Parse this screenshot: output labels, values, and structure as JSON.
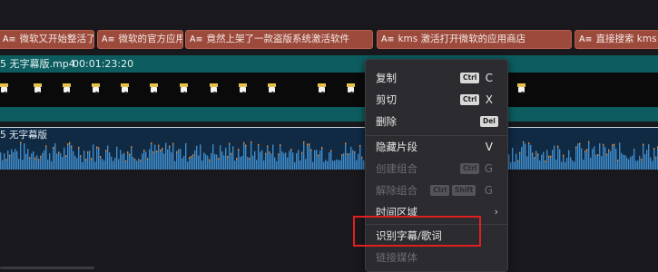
{
  "subtitle_track": {
    "tag": "A≡",
    "clips": [
      {
        "text": "微软又开始整活了"
      },
      {
        "text": "微软的官方应用"
      },
      {
        "text": "竟然上架了一款盗版系统激活软件"
      },
      {
        "text": "kms 激活打开微软的应用商店"
      },
      {
        "text": "直接搜索 kms"
      }
    ]
  },
  "video_track": {
    "name": "5 无字幕版.mp4",
    "duration": "00:01:23:20",
    "thumbnail_icon": "clip-thumbnail-icon"
  },
  "audio_track": {
    "name": "5 无字幕版",
    "waveform_color": "#3f8bc9",
    "peak_color": "#e08a3c"
  },
  "context_menu": {
    "items": [
      {
        "label": "复制",
        "shortcut_mod": "Ctrl",
        "shortcut_key": "C",
        "enabled": true
      },
      {
        "label": "剪切",
        "shortcut_mod": "Ctrl",
        "shortcut_key": "X",
        "enabled": true
      },
      {
        "label": "删除",
        "shortcut_key_badge": "Del",
        "enabled": true
      },
      {
        "label": "隐藏片段",
        "shortcut_key": "V",
        "enabled": true
      },
      {
        "label": "创建组合",
        "shortcut_mod": "Ctrl",
        "shortcut_key": "G",
        "enabled": false
      },
      {
        "label": "解除组合",
        "shortcut_mod": "Ctrl",
        "shortcut_mod2": "Shift",
        "shortcut_key": "G",
        "enabled": false
      },
      {
        "label": "时间区域",
        "submenu_icon": "chevron-right-icon",
        "enabled": true
      },
      {
        "label": "识别字幕/歌词",
        "enabled": true,
        "highlighted": true
      },
      {
        "label": "链接媒体",
        "enabled": false
      }
    ]
  },
  "colors": {
    "subtitle_clip": "#9c4a3c",
    "video_header": "#0d5c5f",
    "audio_bg": "#102a44",
    "menu_bg": "#2b2b30",
    "highlight_box": "#e02020"
  }
}
